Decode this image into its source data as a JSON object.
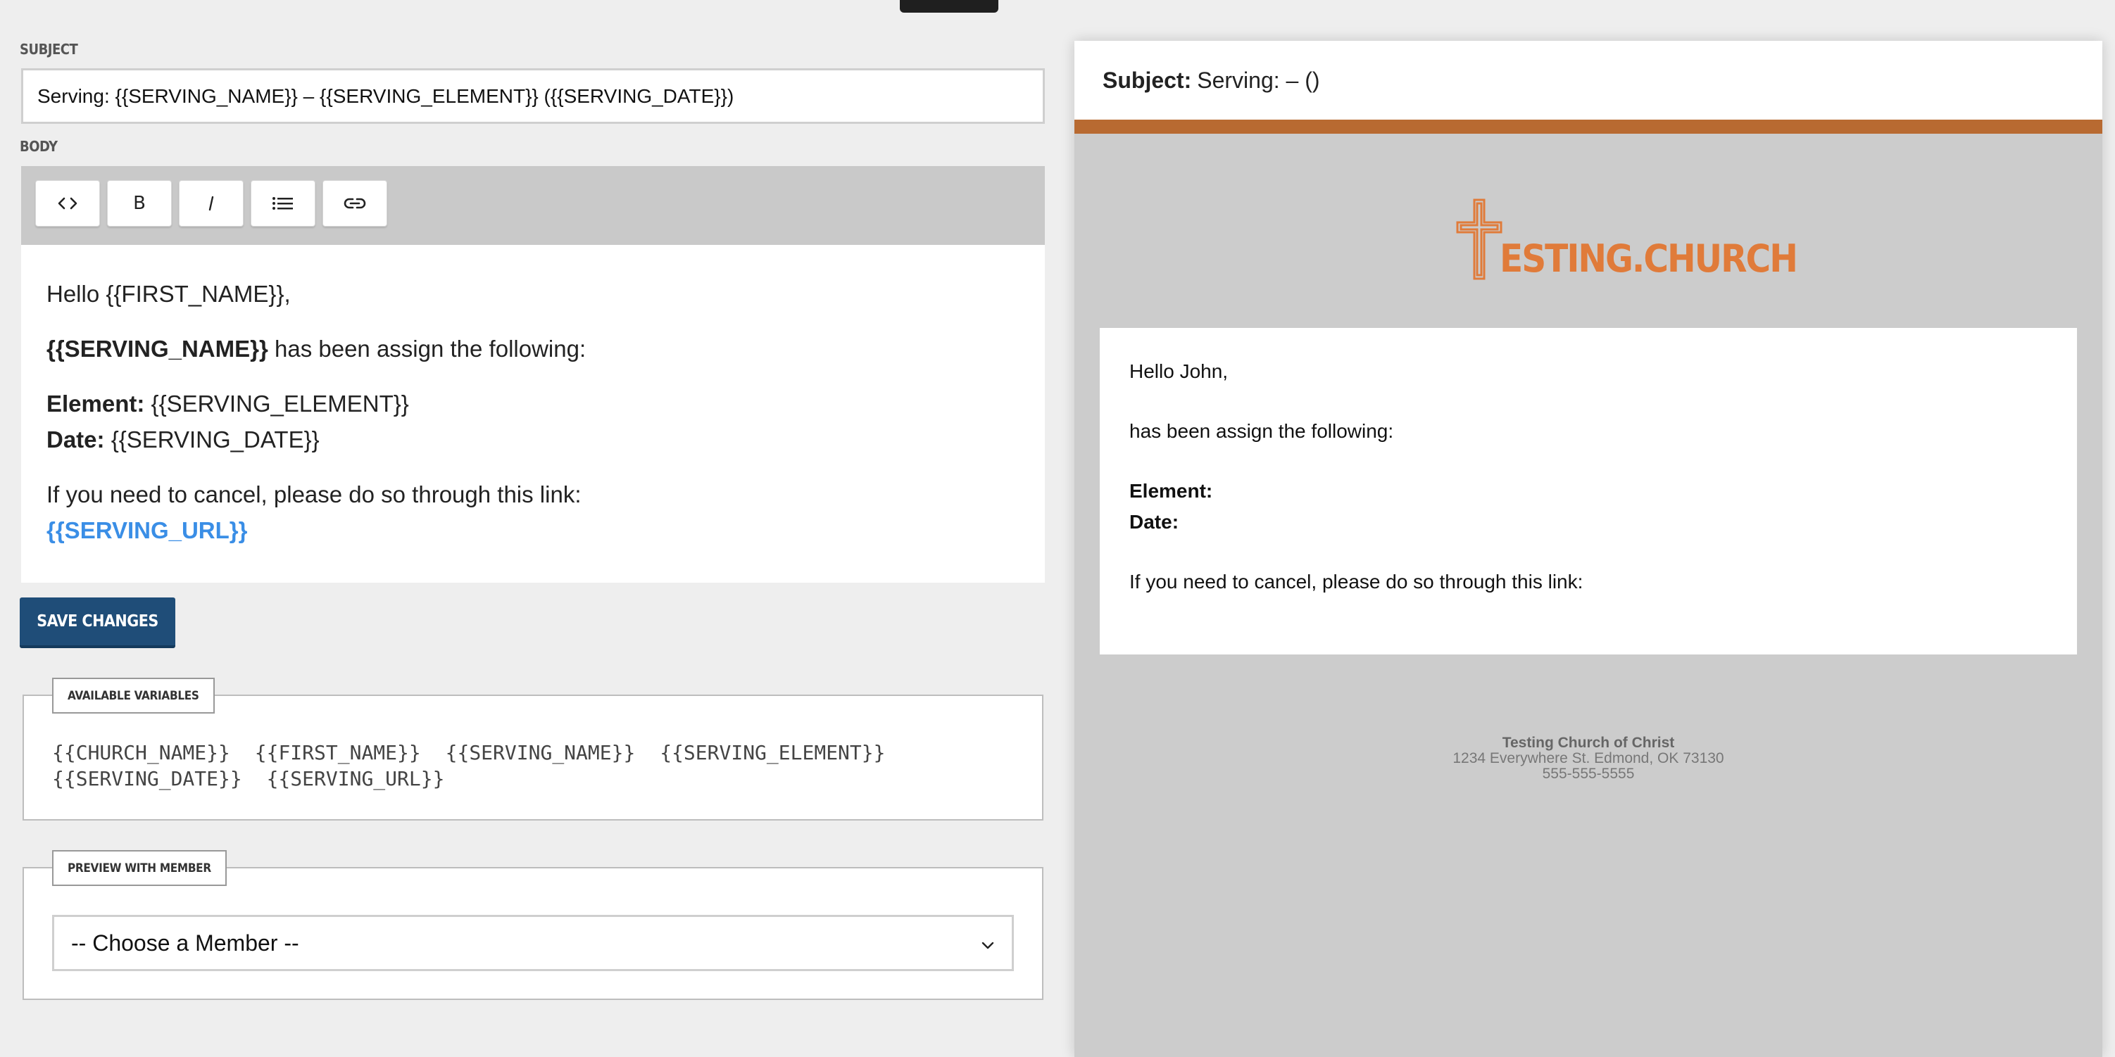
{
  "editor": {
    "subject_label": "SUBJECT",
    "subject_value": "Serving: {{SERVING_NAME}} – {{SERVING_ELEMENT}} ({{SERVING_DATE}})",
    "body_label": "BODY",
    "toolbar": {
      "buttons": [
        {
          "name": "code-view-button",
          "icon": "code-icon"
        },
        {
          "name": "bold-button",
          "icon": "bold-icon",
          "glyph": "B"
        },
        {
          "name": "italic-button",
          "icon": "italic-icon",
          "glyph": "I"
        },
        {
          "name": "list-button",
          "icon": "list-icon"
        },
        {
          "name": "link-button",
          "icon": "link-icon"
        }
      ]
    },
    "body": {
      "greeting": "Hello {{FIRST_NAME}},",
      "assign_var": "{{SERVING_NAME}}",
      "assign_text": " has been assign the following:",
      "element_label": "Element:",
      "element_value": " {{SERVING_ELEMENT}}",
      "date_label": "Date:",
      "date_value": " {{SERVING_DATE}}",
      "cancel_text": "If you need to cancel, please do so through this link:",
      "cancel_link": "{{SERVING_URL}}"
    },
    "save_label": "SAVE CHANGES",
    "variables": {
      "legend": "AVAILABLE VARIABLES",
      "items": [
        "{{CHURCH_NAME}}",
        "{{FIRST_NAME}}",
        "{{SERVING_NAME}}",
        "{{SERVING_ELEMENT}}",
        "{{SERVING_DATE}}",
        "{{SERVING_URL}}"
      ]
    },
    "preview_member": {
      "legend": "PREVIEW WITH MEMBER",
      "selected": "-- Choose a Member --"
    }
  },
  "preview": {
    "subject_label": "Subject:",
    "subject_value": "Serving: – ()",
    "accent_color": "#b86a31",
    "logo_text": "ESTING.CHURCH",
    "logo_color": "#e07b3a",
    "greeting": "Hello John,",
    "assign_text": "has been assign the following:",
    "element_label": "Element:",
    "date_label": "Date:",
    "cancel_text": "If you need to cancel, please do so through this link:",
    "footer": {
      "org": "Testing Church of Christ",
      "address": "1234 Everywhere St. Edmond, OK 73130",
      "phone": "555-555-5555"
    }
  }
}
